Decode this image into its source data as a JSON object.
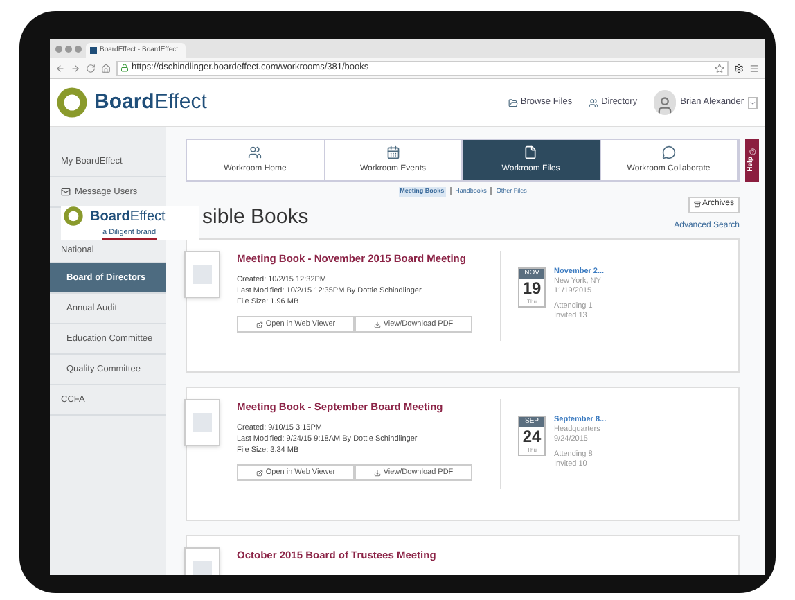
{
  "browser": {
    "tab_title": "BoardEffect - BoardEffect",
    "url": "https://dschindlinger.boardeffect.com/workrooms/381/books"
  },
  "header": {
    "logo": "**Board**Effect",
    "nav": [
      {
        "kind": "folder",
        "label": "Browse Files"
      },
      {
        "kind": "people",
        "label": "Directory"
      }
    ],
    "user": "Brian Alexander"
  },
  "overlay": {
    "logo": "**Board**Effect",
    "tagline": "a Diligent brand"
  },
  "sidebar": {
    "items": [
      {
        "label": "My BoardEffect",
        "icon": false,
        "selected": false
      },
      {
        "label": "Message Users",
        "icon": true,
        "selected": false
      },
      {
        "label": "National",
        "icon": false,
        "selected": false,
        "children": [
          {
            "label": "Board of Directors",
            "selected": true
          },
          {
            "label": "Annual Audit",
            "selected": false
          },
          {
            "label": "Education Committee",
            "selected": false
          },
          {
            "label": "Quality Committee",
            "selected": false
          }
        ]
      },
      {
        "label": "CCFA",
        "icon": false,
        "selected": false
      }
    ]
  },
  "tabs": [
    {
      "kind": "home",
      "label": "Workroom Home",
      "selected": false
    },
    {
      "kind": "events",
      "label": "Workroom Events",
      "selected": false
    },
    {
      "kind": "files",
      "label": "Workroom Files",
      "selected": true
    },
    {
      "kind": "collaborate",
      "label": "Workroom Collaborate",
      "selected": false
    }
  ],
  "help": "Help",
  "sublinks": [
    {
      "label": "Meeting Books",
      "selected": true
    },
    {
      "label": "Handbooks",
      "selected": false
    },
    {
      "label": "Other Files",
      "selected": false
    }
  ],
  "archives": "Archives",
  "advanced_search": "Advanced Search",
  "title": "sible Books",
  "books": [
    {
      "title": "Meeting Book - November 2015 Board Meeting",
      "details": [
        "Created: 10/2/15 12:32PM",
        "Last Modified: 10/2/15 12:35PM By Dottie Schindlinger",
        "File Size: 1.96 MB"
      ],
      "buttons": [
        {
          "kind": "open",
          "label": "Open in Web Viewer"
        },
        {
          "kind": "download",
          "label": "View/Download PDF"
        }
      ],
      "event": {
        "month": "NOV",
        "day": "19",
        "weekday": "Thu",
        "name": "November 2...",
        "place": "New York, NY",
        "date": "11/19/2015",
        "attending": "Attending 1",
        "invited": "Invited 13"
      }
    },
    {
      "title": "Meeting Book - September Board Meeting",
      "details": [
        "Created: 9/10/15 3:15PM",
        "Last Modified: 9/24/15 9:18AM By Dottie Schindlinger",
        "File Size: 3.34 MB"
      ],
      "buttons": [
        {
          "kind": "open",
          "label": "Open in Web Viewer"
        },
        {
          "kind": "download",
          "label": "View/Download PDF"
        }
      ],
      "event": {
        "month": "SEP",
        "day": "24",
        "weekday": "Thu",
        "name": "September 8...",
        "place": "Headquarters",
        "date": "9/24/2015",
        "attending": "Attending 8",
        "invited": "Invited 10"
      }
    },
    {
      "title": "October 2015 Board of Trustees Meeting"
    }
  ]
}
